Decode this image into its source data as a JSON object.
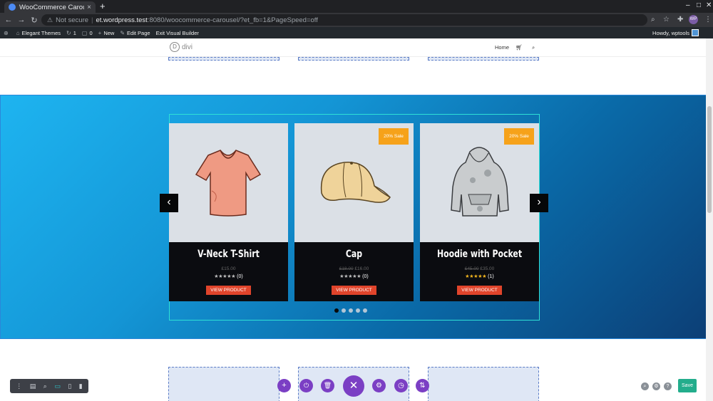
{
  "browser": {
    "tab_title": "WooCommerce Carousel",
    "tab_close": "×",
    "new_tab": "+",
    "address_secure_label": "Not secure",
    "address_host": "et.wordpress.test",
    "address_path": ":8080/woocommerce-carousel/?et_fb=1&PageSpeed=off",
    "profile_initials": "WP"
  },
  "wp_admin_bar": {
    "site_name": "Elegant Themes",
    "updates_count": "1",
    "comments_count": "0",
    "new_label": "New",
    "edit_page_label": "Edit Page",
    "exit_builder_label": "Exit Visual Builder",
    "howdy_label": "Howdy, wptools"
  },
  "site": {
    "logo_letter": "D",
    "logo_word": "divi",
    "menu_home": "Home"
  },
  "carousel": {
    "prev_arrow": "‹",
    "next_arrow": "›",
    "products": [
      {
        "name": "V-Neck T-Shirt",
        "price": "£15.00",
        "old_price": "",
        "sale_badge": "",
        "stars": "★★★★★",
        "rating_count": "(0)",
        "button": "VIEW PRODUCT"
      },
      {
        "name": "Cap",
        "price": "£16.00",
        "old_price": "£18.00",
        "sale_badge": "20% Sale",
        "stars": "★★★★★",
        "rating_count": "(0)",
        "button": "VIEW PRODUCT"
      },
      {
        "name": "Hoodie with Pocket",
        "price": "£35.00",
        "old_price": "£45.00",
        "sale_badge": "20% Sale",
        "stars": "★★★★★",
        "rating_count": "(1)",
        "button": "VIEW PRODUCT"
      }
    ],
    "dots_total": 5,
    "active_dot": 1
  },
  "builder": {
    "save_label": "Save",
    "colors": {
      "accent": "#7b3fc4",
      "save": "#23ad8c",
      "sale": "#f6a21a",
      "view_product": "#e0442b"
    }
  }
}
